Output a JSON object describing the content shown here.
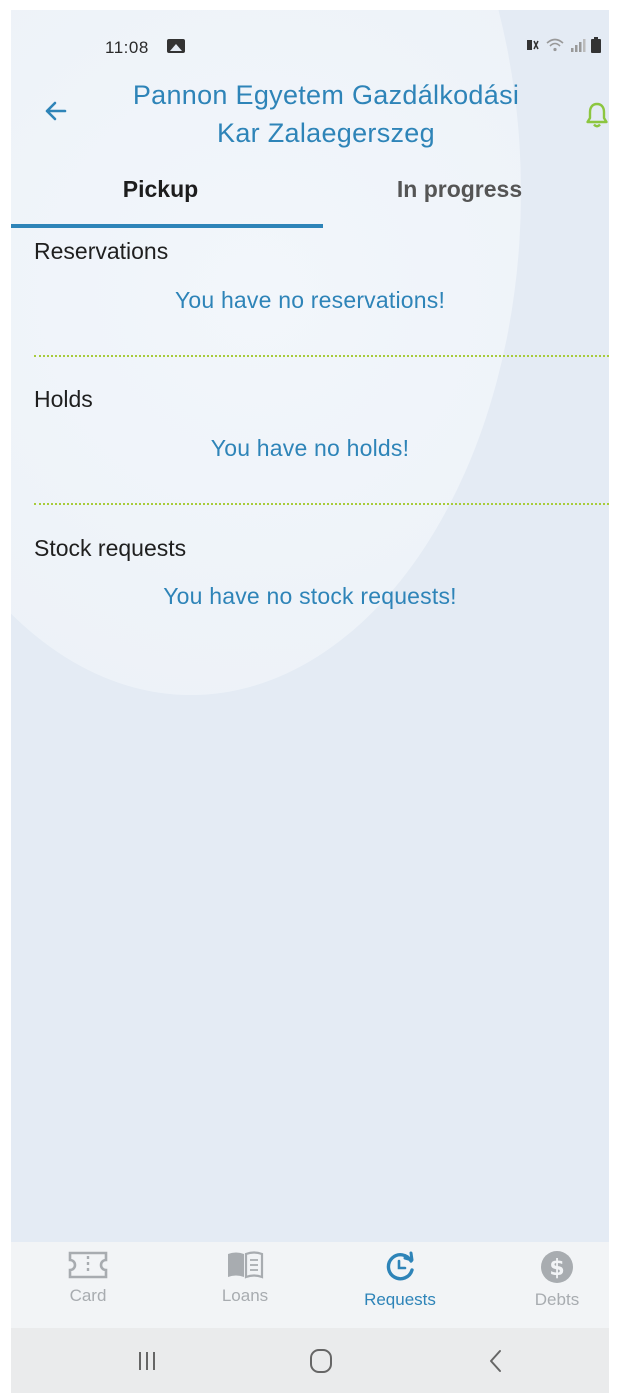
{
  "status_bar": {
    "time": "11:08"
  },
  "header": {
    "title_line1": "Pannon Egyetem Gazdálkodási",
    "title_line2": "Kar Zalaegerszeg"
  },
  "tabs": [
    {
      "label": "Pickup",
      "active": true
    },
    {
      "label": "In progress",
      "active": false
    }
  ],
  "sections": {
    "reservations": {
      "title": "Reservations",
      "empty": "You have no reservations!"
    },
    "holds": {
      "title": "Holds",
      "empty": "You have no holds!"
    },
    "stock_requests": {
      "title": "Stock requests",
      "empty": "You have no stock requests!"
    }
  },
  "bottom_nav": [
    {
      "label": "Card",
      "icon": "card-icon",
      "active": false
    },
    {
      "label": "Loans",
      "icon": "book-icon",
      "active": false
    },
    {
      "label": "Requests",
      "icon": "clock-refresh-icon",
      "active": true
    },
    {
      "label": "Debts",
      "icon": "dollar-icon",
      "active": false
    }
  ],
  "colors": {
    "accent": "#2e84b8",
    "divider": "#a8cc3a",
    "bell": "#8cc63f",
    "inactive": "#a8acb0"
  }
}
